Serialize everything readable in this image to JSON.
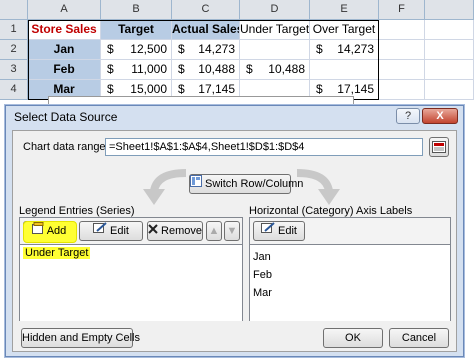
{
  "sheet": {
    "columns": [
      "A",
      "B",
      "C",
      "D",
      "E",
      "F"
    ],
    "rows": [
      "1",
      "2",
      "3",
      "4"
    ],
    "header": {
      "store_sales": "Store Sales",
      "target": "Target",
      "actual_sales": "Actual Sales",
      "under_target": "Under Target",
      "over_target": "Over Target"
    },
    "data": [
      {
        "month": "Jan",
        "target": "12,500",
        "actual": "14,273",
        "under": "",
        "over": "14,273"
      },
      {
        "month": "Feb",
        "target": "11,000",
        "actual": "10,488",
        "under": "10,488",
        "over": ""
      },
      {
        "month": "Mar",
        "target": "15,000",
        "actual": "17,145",
        "under": "",
        "over": "17,145"
      }
    ],
    "currency": "$"
  },
  "dialog": {
    "title": "Select Data Source",
    "help_label": "?",
    "close_label": "X",
    "range_label": "Chart data range:",
    "range_value": "=Sheet1!$A$1:$A$4,Sheet1!$D$1:$D$4",
    "switch_label": "Switch Row/Column",
    "legend_title": "Legend Entries (Series)",
    "add_label": "Add",
    "edit_label": "Edit",
    "remove_label": "Remove",
    "series": [
      "Under Target"
    ],
    "axis_title": "Horizontal (Category) Axis Labels",
    "axis_edit_label": "Edit",
    "categories": [
      "Jan",
      "Feb",
      "Mar"
    ],
    "hidden_label": "Hidden and Empty Cells",
    "ok_label": "OK",
    "cancel_label": "Cancel"
  }
}
